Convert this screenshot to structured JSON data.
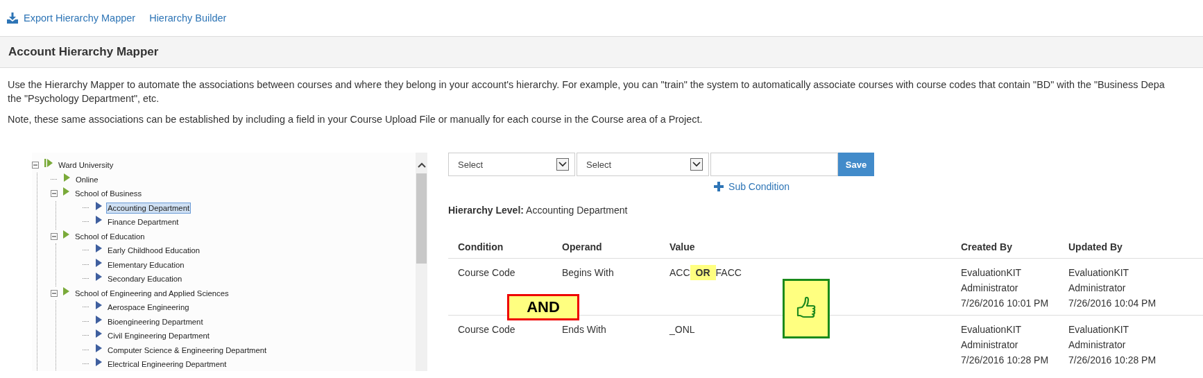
{
  "top_links": [
    {
      "label": "Export Hierarchy Mapper",
      "kind": "export"
    },
    {
      "label": "Hierarchy Builder",
      "kind": "plain"
    }
  ],
  "page_title": "Account Hierarchy Mapper",
  "description_lines": [
    "Use the Hierarchy Mapper to automate the associations between courses and where they belong in your account's hierarchy. For example, you can \"train\" the system to automatically associate courses with course codes that contain \"BD\" with the \"Business Depa",
    "the \"Psychology Department\", etc."
  ],
  "note": "Note, these same associations can be established by including a field in your Course Upload File or manually for each course in the Course area of a Project.",
  "tree": [
    {
      "label": "Ward University",
      "kind": "root",
      "expanded": true,
      "selected": false,
      "children": [
        {
          "label": "Online",
          "kind": "group",
          "selected": false
        },
        {
          "label": "School of Business",
          "kind": "group",
          "expanded": true,
          "selected": false,
          "children": [
            {
              "label": "Accounting Department",
              "kind": "leaf",
              "selected": true
            },
            {
              "label": "Finance Department",
              "kind": "leaf",
              "selected": false
            }
          ]
        },
        {
          "label": "School of Education",
          "kind": "group",
          "expanded": true,
          "selected": false,
          "children": [
            {
              "label": "Early Childhood Education",
              "kind": "leaf",
              "selected": false
            },
            {
              "label": "Elementary Education",
              "kind": "leaf",
              "selected": false
            },
            {
              "label": "Secondary Education",
              "kind": "leaf",
              "selected": false
            }
          ]
        },
        {
          "label": "School of Engineering and Applied Sciences",
          "kind": "group",
          "expanded": true,
          "selected": false,
          "children": [
            {
              "label": "Aerospace Engineering",
              "kind": "leaf",
              "selected": false
            },
            {
              "label": "Bioengineering Department",
              "kind": "leaf",
              "selected": false
            },
            {
              "label": "Civil Engineering Department",
              "kind": "leaf",
              "selected": false
            },
            {
              "label": "Computer Science & Engineering Department",
              "kind": "leaf",
              "selected": false
            },
            {
              "label": "Electrical Engineering Department",
              "kind": "leaf",
              "selected": false
            }
          ]
        }
      ]
    }
  ],
  "condition_form": {
    "selects": [
      "Select",
      "Select"
    ],
    "save_button": "Save",
    "sub_condition_link": "Sub Condition"
  },
  "hierarchy_level": {
    "label": "Hierarchy Level:",
    "value": "Accounting Department"
  },
  "table": {
    "columns": [
      "Condition",
      "Operand",
      "Value",
      "Created By",
      "Updated By"
    ],
    "rows": [
      {
        "condition": "Course Code",
        "operand": "Begins With",
        "value_parts": [
          {
            "text": "ACC",
            "highlighted": false
          },
          {
            "text": "OR",
            "highlighted": true
          },
          {
            "text": "FACC",
            "highlighted": false
          }
        ],
        "created_by": [
          "EvaluationKIT",
          "Administrator",
          "7/26/2016 10:01 PM"
        ],
        "updated_by": [
          "EvaluationKIT",
          "Administrator",
          "7/26/2016 10:04 PM"
        ]
      },
      {
        "condition": "Course Code",
        "operand": "Ends With",
        "value_parts": [
          {
            "text": "_ONL",
            "highlighted": false
          }
        ],
        "created_by": [
          "EvaluationKIT",
          "Administrator",
          "7/26/2016 10:28 PM"
        ],
        "updated_by": [
          "EvaluationKIT",
          "Administrator",
          "7/26/2016 10:28 PM"
        ]
      }
    ]
  },
  "callouts": [
    {
      "kind": "text",
      "text": "AND"
    },
    {
      "kind": "thumbs_up"
    }
  ]
}
